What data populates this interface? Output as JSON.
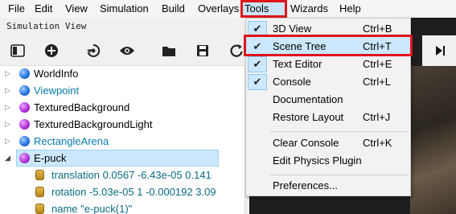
{
  "menubar": {
    "items": [
      {
        "label": "File"
      },
      {
        "label": "Edit"
      },
      {
        "label": "View"
      },
      {
        "label": "Simulation"
      },
      {
        "label": "Build"
      },
      {
        "label": "Overlays"
      },
      {
        "label": "Tools"
      },
      {
        "label": "Wizards"
      },
      {
        "label": "Help"
      }
    ]
  },
  "panel": {
    "title": "Simulation View"
  },
  "toolbar": {
    "icons": [
      "toggle-panel-icon",
      "add-node-icon",
      "reset-view-icon",
      "eye-icon",
      "open-folder-icon",
      "save-icon",
      "reload-icon"
    ]
  },
  "scene_tree": {
    "nodes": [
      {
        "label": "WorldInfo",
        "color": "#000000",
        "ball": "blue"
      },
      {
        "label": "Viewpoint",
        "color": "#0a7bb0",
        "ball": "blue"
      },
      {
        "label": "TexturedBackground",
        "color": "#000000",
        "ball": "purple"
      },
      {
        "label": "TexturedBackgroundLight",
        "color": "#000000",
        "ball": "purple"
      },
      {
        "label": "RectangleArena",
        "color": "#0a7bb0",
        "ball": "blue"
      },
      {
        "label": "E-puck",
        "color": "#000000",
        "ball": "purple",
        "selected": true,
        "expanded": true
      }
    ],
    "fields": [
      {
        "label": "translation 0.0567 -6.43e-05 0.141"
      },
      {
        "label": "rotation -5.03e-05 1 -0.000192 3.09"
      },
      {
        "label": "name \"e-puck(1)\""
      }
    ]
  },
  "tools_menu": {
    "items": [
      {
        "label": "3D View",
        "shortcut": "Ctrl+B",
        "checked": true
      },
      {
        "label": "Scene Tree",
        "shortcut": "Ctrl+T",
        "checked": true,
        "highlighted": true
      },
      {
        "label": "Text Editor",
        "shortcut": "Ctrl+E",
        "checked": true
      },
      {
        "label": "Console",
        "shortcut": "Ctrl+L",
        "checked": true
      },
      {
        "label": "Documentation",
        "shortcut": "",
        "checked": false
      },
      {
        "label": "Restore Layout",
        "shortcut": "Ctrl+J",
        "checked": false
      },
      {
        "label": "Clear Console",
        "shortcut": "Ctrl+K",
        "checked": false
      },
      {
        "label": "Edit Physics Plugin",
        "shortcut": "",
        "checked": false
      },
      {
        "label": "Preferences...",
        "shortcut": "",
        "checked": false
      }
    ]
  },
  "colors": {
    "highlight_border": "#e0141b",
    "selection": "#cce8ff",
    "field_text": "#0a6a83",
    "link_text": "#0a7bb0"
  }
}
